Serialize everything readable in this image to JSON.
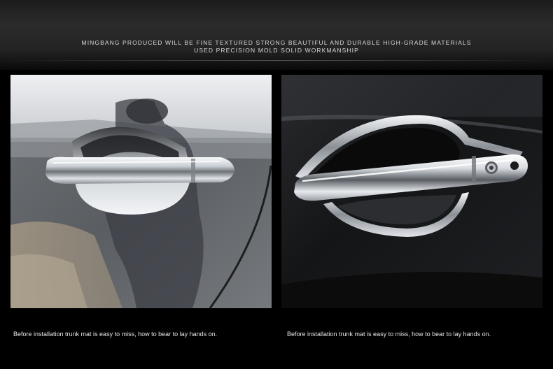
{
  "banner": {
    "line1": "MINGBANG PRODUCED WILL BE FINE TEXTURED STRONG BEAUTIFUL AND DURABLE HIGH-GRADE MATERIALS",
    "line2": "USED PRECISION MOLD SOLID WORKMANSHIP"
  },
  "photos": [
    {
      "caption": "Before installation trunk mat is easy to miss, how to bear to lay hands on."
    },
    {
      "caption": "Before installation trunk mat is easy to miss, how to bear to lay hands on."
    }
  ],
  "colors": {
    "page_background": "#000000",
    "caption_text": "#e6e6e6",
    "chrome": "#d9dde2"
  }
}
